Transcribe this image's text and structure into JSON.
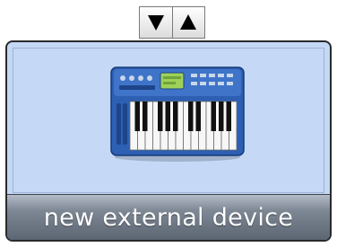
{
  "stepper": {
    "down_icon": "triangle-down-icon",
    "up_icon": "triangle-up-icon"
  },
  "device": {
    "name": "new external device",
    "icon": "midi-keyboard-icon",
    "colors": {
      "card_background": "#c5d9f7",
      "name_bar": "#7e8794",
      "keyboard_body": "#2d5fb3"
    }
  }
}
